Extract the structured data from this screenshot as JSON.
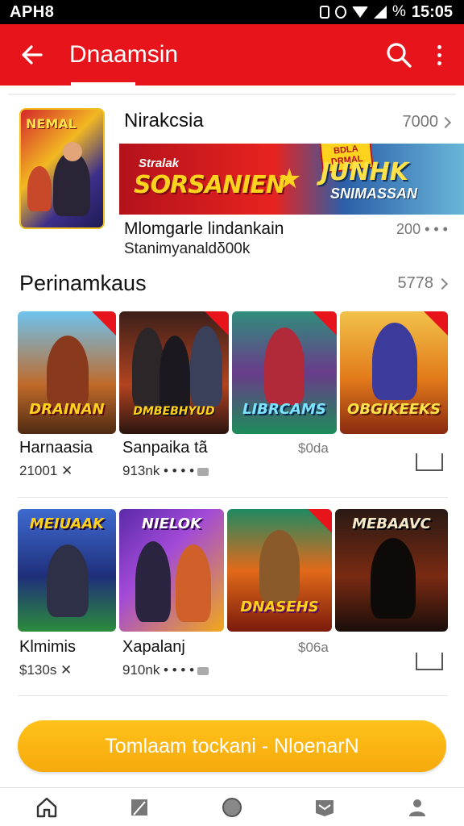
{
  "status_bar": {
    "left_time": "APH8",
    "right_time": "15:05",
    "battery_text": "%"
  },
  "app_bar": {
    "title": "Dnaamsin",
    "back_icon": "arrow-left-icon",
    "search_icon": "search-icon",
    "more_icon": "more-vert-icon"
  },
  "featured": {
    "title": "Nirakcsia",
    "count": "7000",
    "thumb_text": "NEMAL",
    "banner": {
      "left_small": "Stralak",
      "left_big": "SORSANIEN",
      "badge": "BDLA DRMAL",
      "right_big": "JUNHK",
      "right_small": "SNIMASSAN"
    },
    "desc_line1": "Mlomgarle lindankain",
    "desc_line2": "Stanimyanaldδ00k",
    "meta": "200 • • •"
  },
  "section": {
    "title": "Perinamkaus",
    "count": "5778"
  },
  "row1": {
    "tiles": [
      {
        "text": "DRAINAN",
        "icon": "game-art-warrior"
      },
      {
        "text": "DMBEBHYUD",
        "icon": "game-art-heroes"
      },
      {
        "text": "LIBRCAMS",
        "icon": "game-art-knight"
      },
      {
        "text": "OBGIKEEKS",
        "icon": "game-art-fighter"
      }
    ],
    "card1": {
      "name": "Harnaasia",
      "meta": "21001 ✕"
    },
    "card2": {
      "name": "Sanpaika tã",
      "meta": "913nk • • • •"
    },
    "price": "$0da"
  },
  "row2": {
    "tiles": [
      {
        "text": "MEIUAAK",
        "icon": "game-art-soldier"
      },
      {
        "text": "NIELOK",
        "icon": "game-art-duo"
      },
      {
        "text": "DNASEHS",
        "icon": "game-art-samurai"
      },
      {
        "text": "MEBAAVC",
        "icon": "game-art-ninja"
      }
    ],
    "card1": {
      "name": "Klmimis",
      "meta": "$130s ✕"
    },
    "card2": {
      "name": "Xapalanj",
      "meta": "910nk • • • •"
    },
    "price": "$06a"
  },
  "cta": {
    "label": "Tomlaam tockani - NloenarN"
  },
  "bottom_nav": [
    "home-icon",
    "edit-icon",
    "circle-icon",
    "inbox-icon",
    "profile-icon"
  ],
  "colors": {
    "brand_red": "#e8141b",
    "cta_orange": "#f6a90c"
  }
}
